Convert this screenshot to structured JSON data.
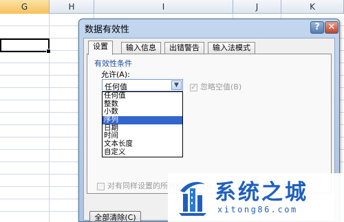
{
  "spreadsheet": {
    "columns": [
      {
        "label": "G"
      },
      {
        "label": "H"
      },
      {
        "label": "I"
      },
      {
        "label": "J"
      },
      {
        "label": "K"
      }
    ]
  },
  "dialog": {
    "title": "数据有效性",
    "help_label": "?",
    "close_label": "✕",
    "tabs": [
      {
        "label": "设置",
        "active": true
      },
      {
        "label": "输入信息",
        "active": false
      },
      {
        "label": "出错警告",
        "active": false
      },
      {
        "label": "输入法模式",
        "active": false
      }
    ],
    "group_label": "有效性条件",
    "allow_label": "允许(A):",
    "allow_value": "任何值",
    "allow_options": [
      "任何值",
      "整数",
      "小数",
      "序列",
      "日期",
      "时间",
      "文本长度",
      "自定义"
    ],
    "highlighted_option": "序列",
    "ignore_blank_label": "忽略空值(B)",
    "ignore_blank_checked": true,
    "apply_all_label": "对有同样设置的所有其他单元格应用这些更改(P)",
    "clear_all_label": "全部清除(C)"
  },
  "watermark": {
    "title": "系统之城",
    "url": "xitong86.com"
  },
  "colors": {
    "selected_option": "#3366cc",
    "dialog_frame": "#a9c3e6",
    "watermark": "#1f5fbf"
  }
}
